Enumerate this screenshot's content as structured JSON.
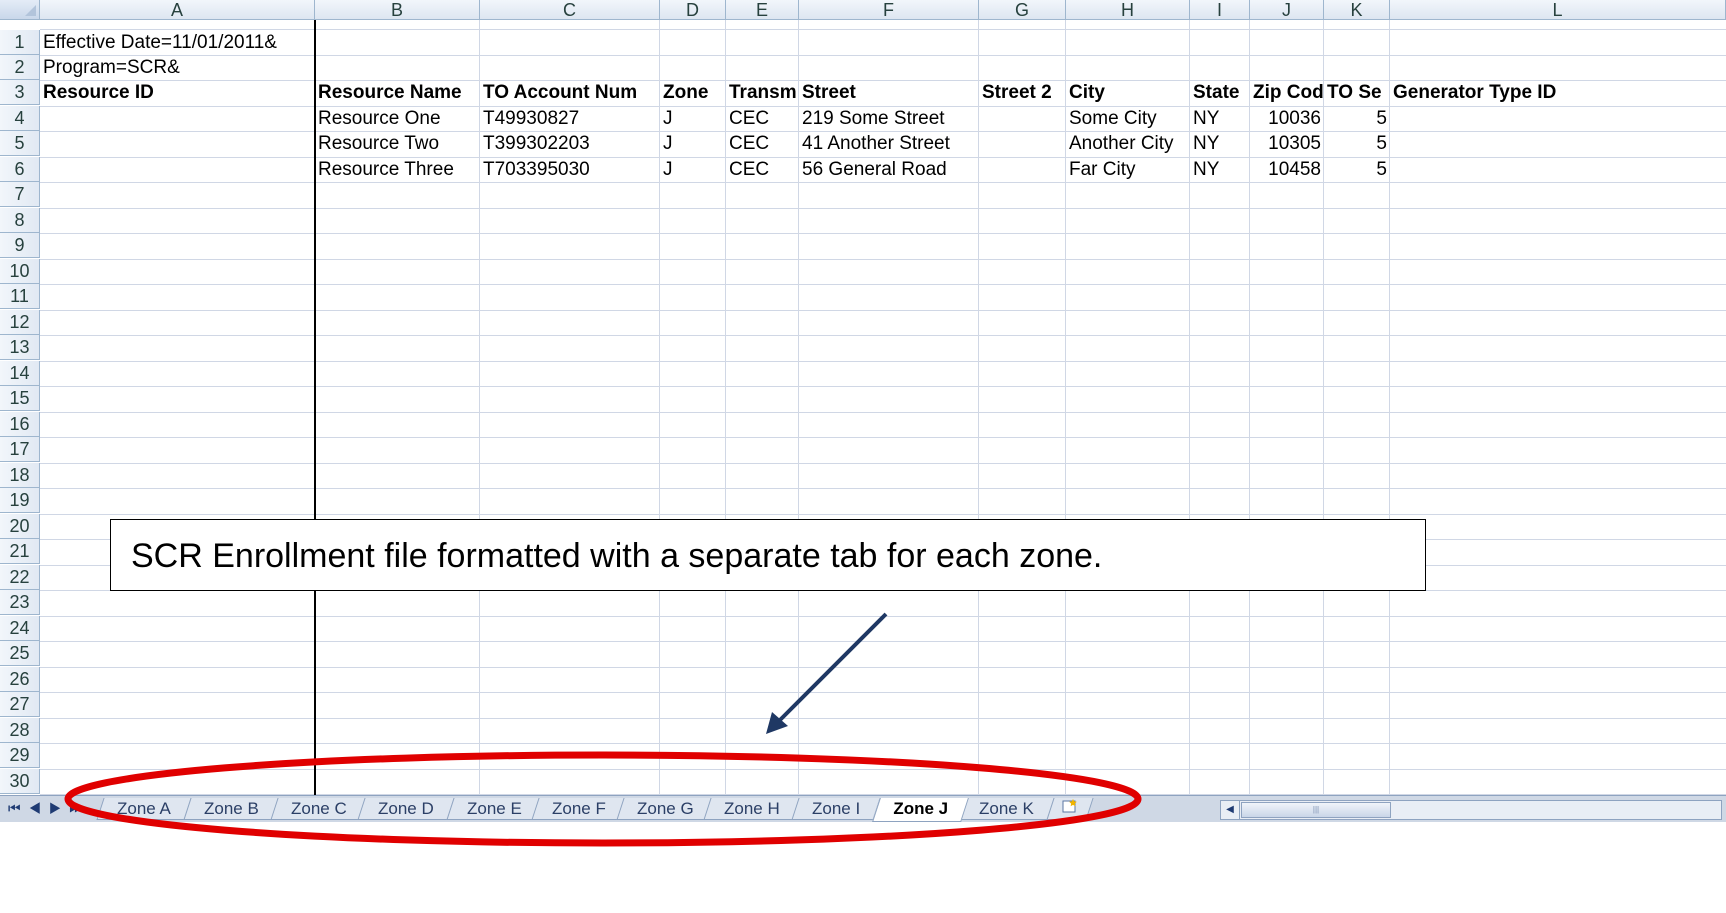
{
  "columns": [
    "A",
    "B",
    "C",
    "D",
    "E",
    "F",
    "G",
    "H",
    "I",
    "J",
    "K",
    "L"
  ],
  "row_numbers": [
    "1",
    "2",
    "3",
    "4",
    "5",
    "6",
    "7",
    "8",
    "9",
    "10",
    "11",
    "12",
    "13",
    "14",
    "15",
    "16",
    "17",
    "18",
    "19",
    "20",
    "21",
    "22",
    "23",
    "24",
    "25",
    "26",
    "27",
    "28",
    "29",
    "30"
  ],
  "rows": {
    "r1": {
      "A": "Effective Date=11/01/2011&"
    },
    "r2": {
      "A": "Program=SCR&"
    },
    "r3": {
      "A": "Resource ID",
      "B": "Resource Name",
      "C": "TO Account Num",
      "D": "Zone",
      "E": "Transm",
      "F": "Street",
      "G": "Street 2",
      "H": "City",
      "I": "State",
      "J": "Zip Cod",
      "K": "TO Se",
      "L": "Generator Type ID"
    },
    "data": [
      {
        "B": "Resource One",
        "C": "T49930827",
        "D": "J",
        "E": "CEC",
        "F": "219 Some Street",
        "H": "Some City",
        "I": "NY",
        "J": "10036",
        "K": "5"
      },
      {
        "B": "Resource Two",
        "C": "T399302203",
        "D": "J",
        "E": "CEC",
        "F": "41 Another Street",
        "H": "Another City",
        "I": "NY",
        "J": "10305",
        "K": "5"
      },
      {
        "B": "Resource Three",
        "C": "T703395030",
        "D": "J",
        "E": "CEC",
        "F": "56 General Road",
        "H": "Far City",
        "I": "NY",
        "J": "10458",
        "K": "5"
      }
    ]
  },
  "sheet_tabs": [
    "Zone A",
    "Zone B",
    "Zone C",
    "Zone D",
    "Zone E",
    "Zone F",
    "Zone G",
    "Zone H",
    "Zone I",
    "Zone J",
    "Zone K"
  ],
  "active_tab": "Zone J",
  "nav_buttons": "⏮ ◀ ▶ ⏭",
  "insert_tab_icon": "insert-worksheet-icon",
  "callout": {
    "text": "SCR Enrollment file formatted with a separate tab for each zone."
  },
  "colors": {
    "highlight_ellipse": "#e00000",
    "arrow": "#1f3864",
    "header_bg": "#dde6f1",
    "gridline": "#d0d7e5"
  }
}
